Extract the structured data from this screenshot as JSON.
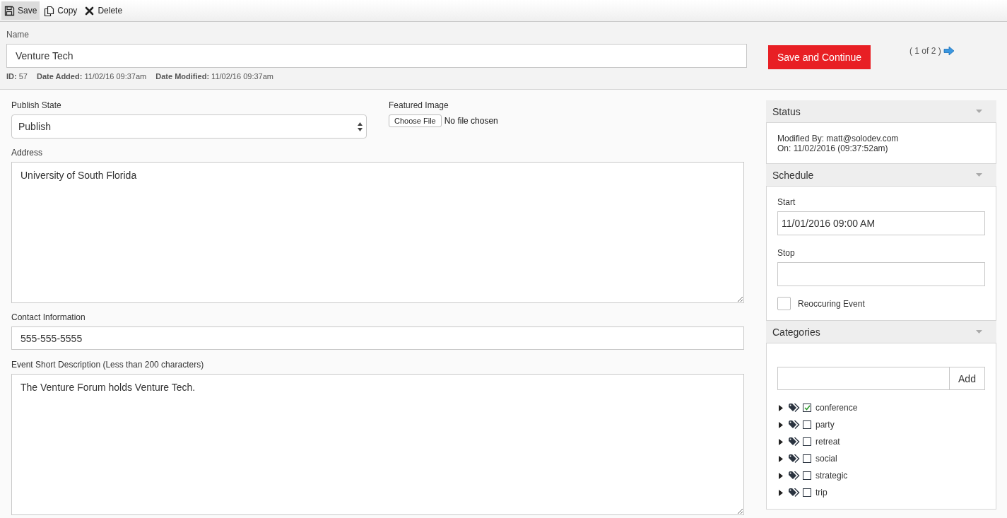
{
  "toolbar": [
    {
      "kind": "save",
      "label": "Save",
      "selected": true
    },
    {
      "kind": "copy",
      "label": "Copy",
      "selected": false
    },
    {
      "kind": "delete",
      "label": "Delete",
      "selected": false
    }
  ],
  "header": {
    "name_label": "Name",
    "name_value": "Venture Tech",
    "meta": [
      "**ID:** 57",
      "**Date Added:** 11/02/16 09:37am",
      "**Date Modified:** 11/02/16 09:37am"
    ],
    "save_continue": "Save and Continue",
    "pager": "( 1 of 2 )"
  },
  "form": {
    "publish_state": {
      "label": "Publish State",
      "value": "Publish"
    },
    "featured_image": {
      "label": "Featured Image",
      "button": "Choose File",
      "status": "No file chosen"
    },
    "address": {
      "label": "Address",
      "value": "University of South Florida"
    },
    "contact": {
      "label": "Contact Information",
      "value": "555-555-5555"
    },
    "short_description": {
      "label": "Event Short Description (Less than 200 characters)",
      "value": "The Venture Forum holds Venture Tech."
    }
  },
  "sidebar": {
    "status": {
      "title": "Status",
      "lines": [
        "Modified By: matt@solodev.com",
        "On: 11/02/2016 (09:37:52am)"
      ]
    },
    "schedule": {
      "title": "Schedule",
      "start_label": "Start",
      "start_value": "11/01/2016 09:00 AM",
      "stop_label": "Stop",
      "reoccurring": {
        "label": "Reoccuring Event",
        "checked": false
      }
    },
    "categories": {
      "title": "Categories",
      "add_button": "Add",
      "items": [
        {
          "label": "conference",
          "checked": true,
          "expanded": false
        },
        {
          "label": "party",
          "checked": false,
          "expanded": false
        },
        {
          "label": "retreat",
          "checked": false,
          "expanded": false
        },
        {
          "label": "social",
          "checked": false,
          "expanded": false
        },
        {
          "label": "strategic",
          "checked": false,
          "expanded": false
        },
        {
          "label": "trip",
          "checked": false,
          "expanded": false
        }
      ]
    }
  }
}
